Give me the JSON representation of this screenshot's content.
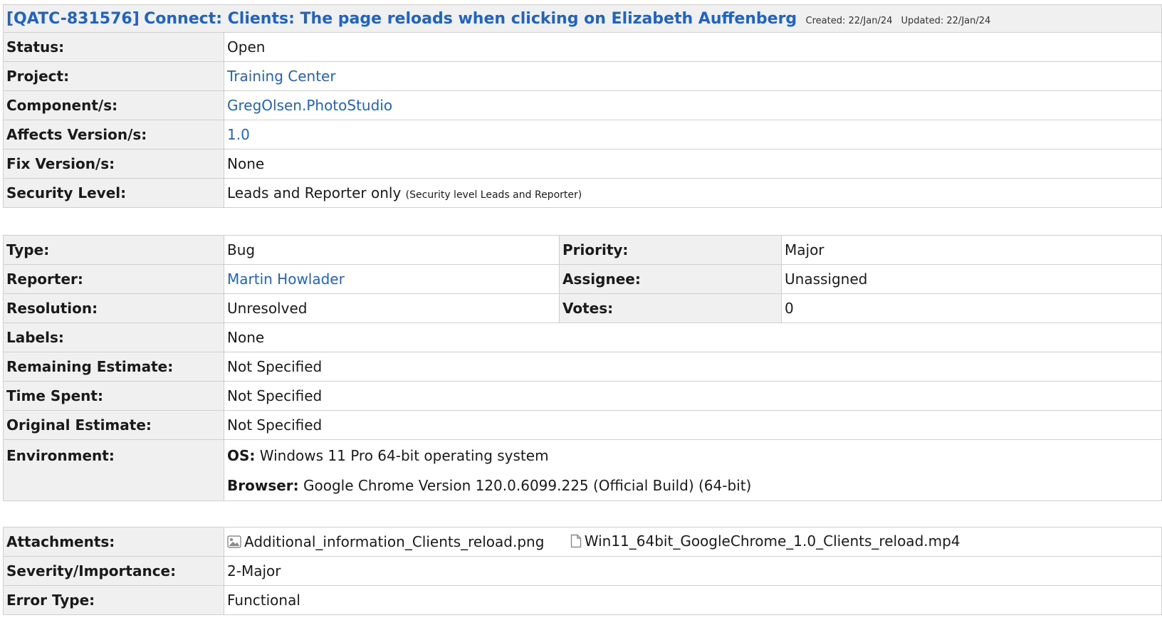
{
  "header": {
    "key": "[QATC-831576]",
    "summary": "Connect: Clients: The page reloads when clicking on Elizabeth Auffenberg",
    "created_label": "Created:",
    "created_value": "22/Jan/24",
    "updated_label": "Updated:",
    "updated_value": "22/Jan/24"
  },
  "details": {
    "status_label": "Status:",
    "status_value": "Open",
    "project_label": "Project:",
    "project_value": "Training Center",
    "component_label": "Component/s:",
    "component_value": "GregOlsen.PhotoStudio",
    "affects_label": "Affects Version/s:",
    "affects_value": "1.0",
    "fix_label": "Fix Version/s:",
    "fix_value": "None",
    "security_label": "Security Level:",
    "security_value": "Leads and Reporter only",
    "security_note": "(Security level Leads and Reporter)"
  },
  "people": {
    "type_label": "Type:",
    "type_value": "Bug",
    "priority_label": "Priority:",
    "priority_value": "Major",
    "reporter_label": "Reporter:",
    "reporter_value": "Martin Howlader",
    "assignee_label": "Assignee:",
    "assignee_value": "Unassigned",
    "resolution_label": "Resolution:",
    "resolution_value": "Unresolved",
    "votes_label": "Votes:",
    "votes_value": "0",
    "labels_label": "Labels:",
    "labels_value": "None",
    "remaining_label": "Remaining Estimate:",
    "remaining_value": "Not Specified",
    "spent_label": "Time Spent:",
    "spent_value": "Not Specified",
    "original_label": "Original Estimate:",
    "original_value": "Not Specified",
    "environment_label": "Environment:",
    "env_os_label": "OS:",
    "env_os_value": "Windows 11 Pro 64-bit operating system",
    "env_browser_label": "Browser:",
    "env_browser_value": "Google Chrome Version 120.0.6099.225 (Official Build) (64-bit)"
  },
  "extra": {
    "attachments_label": "Attachments:",
    "attachments": [
      {
        "name": "Additional_information_Clients_reload.png",
        "icon": "image-file-icon"
      },
      {
        "name": "Win11_64bit_GoogleChrome_1.0_Clients_reload.mp4",
        "icon": "document-file-icon"
      }
    ],
    "severity_label": "Severity/Importance:",
    "severity_value": "2-Major",
    "error_type_label": "Error Type:",
    "error_type_value": "Functional"
  },
  "colors": {
    "link": "#1f63c6",
    "label_bg": "#f0f0f0",
    "border": "#cfcfcf"
  }
}
